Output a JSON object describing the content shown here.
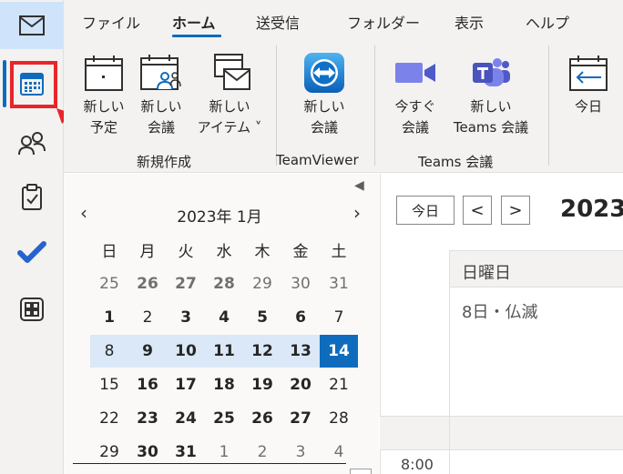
{
  "colors": {
    "accent": "#0f6cbd",
    "highlight_red": "#e8262a",
    "week_band": "#dbe8f7"
  },
  "rail": {
    "items": [
      {
        "name": "mail-icon"
      },
      {
        "name": "calendar-icon"
      },
      {
        "name": "people-icon"
      },
      {
        "name": "todo-icon"
      },
      {
        "name": "check-icon"
      },
      {
        "name": "apps-icon"
      }
    ]
  },
  "ribbon": {
    "tabs": [
      "ファイル",
      "ホーム",
      "送受信",
      "フォルダー",
      "表示",
      "ヘルプ"
    ],
    "active_tab": "ホーム",
    "buttons": {
      "new_appointment": {
        "line1": "新しい",
        "line2": "予定"
      },
      "new_meeting": {
        "line1": "新しい",
        "line2": "会議"
      },
      "new_item": {
        "line1": "新しい",
        "line2": "アイテム ˅"
      },
      "tv_meeting": {
        "line1": "新しい",
        "line2": "会議"
      },
      "meet_now": {
        "line1": "今すぐ",
        "line2": "会議"
      },
      "teams_meeting": {
        "line1": "新しい",
        "line2": "Teams 会議"
      },
      "today": {
        "line1": "今日"
      }
    },
    "groups": {
      "new": "新規作成",
      "teamviewer": "TeamViewer",
      "teams": "Teams 会議"
    }
  },
  "navigator": {
    "month_title": "2023年 1月",
    "prev": "‹",
    "next": "›",
    "weekdays": [
      "日",
      "月",
      "火",
      "水",
      "木",
      "金",
      "土"
    ],
    "weeks": [
      [
        {
          "d": "25",
          "t": "other"
        },
        {
          "d": "26",
          "t": "other bold"
        },
        {
          "d": "27",
          "t": "other bold"
        },
        {
          "d": "28",
          "t": "other bold"
        },
        {
          "d": "29",
          "t": "other"
        },
        {
          "d": "30",
          "t": "other"
        },
        {
          "d": "31",
          "t": "other"
        }
      ],
      [
        {
          "d": "1",
          "t": "bold"
        },
        {
          "d": "2",
          "t": ""
        },
        {
          "d": "3",
          "t": "bold"
        },
        {
          "d": "4",
          "t": "bold"
        },
        {
          "d": "5",
          "t": "bold"
        },
        {
          "d": "6",
          "t": "bold"
        },
        {
          "d": "7",
          "t": ""
        }
      ],
      [
        {
          "d": "8",
          "t": "week"
        },
        {
          "d": "9",
          "t": "week bold"
        },
        {
          "d": "10",
          "t": "week bold"
        },
        {
          "d": "11",
          "t": "week bold"
        },
        {
          "d": "12",
          "t": "week bold"
        },
        {
          "d": "13",
          "t": "week bold"
        },
        {
          "d": "14",
          "t": "today"
        }
      ],
      [
        {
          "d": "15",
          "t": ""
        },
        {
          "d": "16",
          "t": "bold"
        },
        {
          "d": "17",
          "t": "bold"
        },
        {
          "d": "18",
          "t": "bold"
        },
        {
          "d": "19",
          "t": "bold"
        },
        {
          "d": "20",
          "t": "bold"
        },
        {
          "d": "21",
          "t": ""
        }
      ],
      [
        {
          "d": "22",
          "t": ""
        },
        {
          "d": "23",
          "t": "bold"
        },
        {
          "d": "24",
          "t": "bold"
        },
        {
          "d": "25",
          "t": "bold"
        },
        {
          "d": "26",
          "t": "bold"
        },
        {
          "d": "27",
          "t": "bold"
        },
        {
          "d": "28",
          "t": ""
        }
      ],
      [
        {
          "d": "29",
          "t": ""
        },
        {
          "d": "30",
          "t": "bold"
        },
        {
          "d": "31",
          "t": "bold"
        },
        {
          "d": "1",
          "t": "other"
        },
        {
          "d": "2",
          "t": "other"
        },
        {
          "d": "3",
          "t": "other"
        },
        {
          "d": "4",
          "t": "other"
        }
      ]
    ]
  },
  "day_view": {
    "today_button": "今日",
    "prev": "<",
    "next": ">",
    "year_partial": "2023",
    "day_name": "日曜日",
    "day_sub": "8日・仏滅",
    "first_time": "8:00"
  }
}
